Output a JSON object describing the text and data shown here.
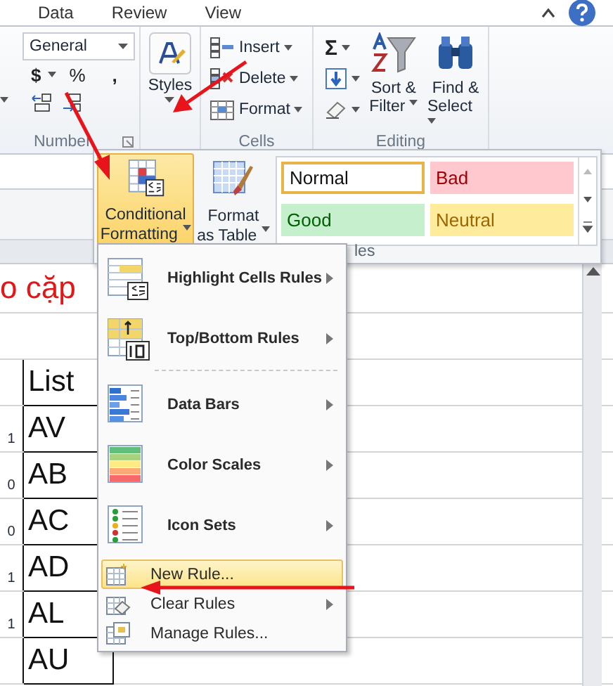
{
  "ribbon_tabs": [
    {
      "label": "Data"
    },
    {
      "label": "Review"
    },
    {
      "label": "View"
    }
  ],
  "number_group": {
    "format": "General",
    "currency": "$",
    "percent": "%",
    "comma": ",",
    "label": "Number"
  },
  "styles_button": {
    "label": "Styles"
  },
  "cells_group": {
    "items": [
      {
        "label": "Insert",
        "kind": "insert"
      },
      {
        "label": "Delete",
        "kind": "delete"
      },
      {
        "label": "Format",
        "kind": "format"
      }
    ],
    "label": "Cells"
  },
  "editing_group": {
    "sum": "Σ",
    "sort": [
      "Sort &",
      "Filter"
    ],
    "find": [
      "Find &",
      "Select"
    ],
    "label": "Editing"
  },
  "styles_panel": {
    "conditional": [
      "Conditional",
      "Formatting"
    ],
    "format_table": [
      "Format",
      "as Table"
    ],
    "cell_styles": [
      {
        "label": "Normal",
        "kind": "normal",
        "selected": true
      },
      {
        "label": "Bad",
        "kind": "bad",
        "selected": false
      },
      {
        "label": "Good",
        "kind": "good",
        "selected": false
      },
      {
        "label": "Neutral",
        "kind": "neutral",
        "selected": false
      }
    ],
    "label": "les"
  },
  "menu": [
    {
      "label": "Highlight Cells Rules",
      "kind": "highlight",
      "submenu": true,
      "selected": false
    },
    {
      "label": "Top/Bottom Rules",
      "kind": "topbottom",
      "submenu": true,
      "selected": false
    },
    {
      "label": "Data Bars",
      "kind": "databars",
      "submenu": true,
      "selected": false
    },
    {
      "label": "Color Scales",
      "kind": "colorscales",
      "submenu": true,
      "selected": false
    },
    {
      "label": "Icon Sets",
      "kind": "iconsets",
      "submenu": true,
      "selected": false
    },
    {
      "label": "New Rule...",
      "kind": "new",
      "submenu": false,
      "selected": true
    },
    {
      "label": "Clear Rules",
      "kind": "clear",
      "submenu": true,
      "selected": false
    },
    {
      "label": "Manage Rules...",
      "kind": "manage",
      "submenu": false,
      "selected": false
    }
  ],
  "sheet": {
    "title": "o cặp",
    "header": "List",
    "rows": [
      {
        "flag": "1",
        "value": "AV"
      },
      {
        "flag": "0",
        "value": "AB"
      },
      {
        "flag": "0",
        "value": "AC"
      },
      {
        "flag": "1",
        "value": "AD"
      },
      {
        "flag": "1",
        "value": "AL"
      },
      {
        "value": "AU"
      }
    ]
  }
}
